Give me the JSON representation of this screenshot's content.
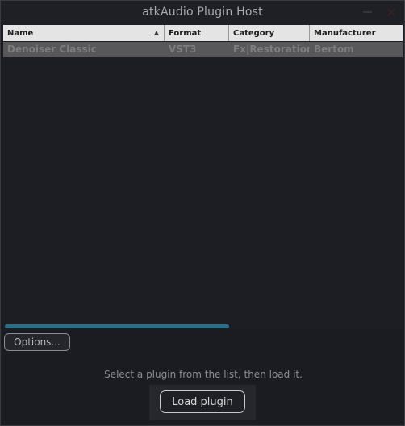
{
  "window": {
    "title": "atkAudio Plugin Host",
    "minimize_glyph": "—",
    "close_glyph": "✕"
  },
  "table": {
    "columns": [
      {
        "label": "Name",
        "sorted": "ascending"
      },
      {
        "label": "Format"
      },
      {
        "label": "Category"
      },
      {
        "label": "Manufacturer"
      }
    ],
    "sort_arrow": "▲",
    "rows": [
      {
        "name": "Denoiser Classic",
        "format": "VST3",
        "category": "Fx|Restoration",
        "manufacturer": "Bertom",
        "selected": true
      }
    ]
  },
  "footer": {
    "options_label": "Options...",
    "hint": "Select a plugin from the list, then load it.",
    "load_label": "Load plugin"
  },
  "colors": {
    "accent": "#2b6f87",
    "background": "#1b1c22",
    "header_bg": "#e4e4e4",
    "selected_row": "#58585a"
  }
}
